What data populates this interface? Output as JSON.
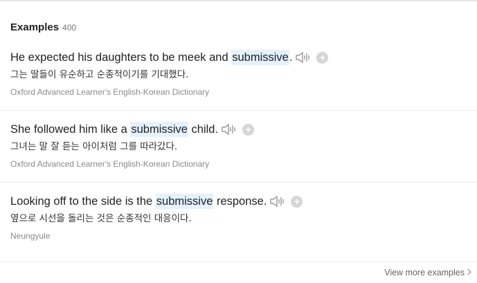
{
  "header": {
    "title": "Examples",
    "count": "400"
  },
  "examples": [
    {
      "before": "He expected his daughters to be meek and ",
      "keyword": "submissive",
      "after": ".",
      "translation": "그는 딸들이 유순하고 순종적이기를 기대했다.",
      "source": "Oxford Advanced Learner's English-Korean Dictionary"
    },
    {
      "before": "She followed him like a ",
      "keyword": "submissive",
      "after": " child.",
      "translation": "그녀는 말 잘 듣는 아이처럼 그를 따라갔다.",
      "source": "Oxford Advanced Learner's English-Korean Dictionary"
    },
    {
      "before": "Looking off to the side is the ",
      "keyword": "submissive",
      "after": " response.",
      "translation": "옆으로 시선을 돌리는 것은 순종적인 대응이다.",
      "source": "Neungyule"
    }
  ],
  "footer": {
    "view_more_label": "View more examples"
  },
  "icons": {
    "speaker": "speaker-icon",
    "add": "plus-circle-icon",
    "chevron": "chevron-right-icon"
  },
  "colors": {
    "highlight": "#e5f1fd",
    "plus_bg": "#d6d6d6"
  }
}
